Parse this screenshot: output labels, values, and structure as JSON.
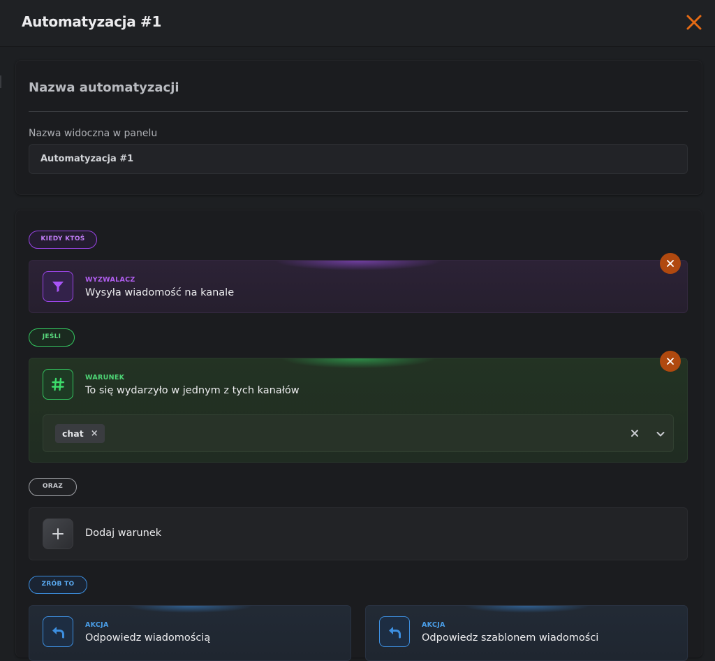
{
  "modal": {
    "title": "Automatyzacja #1",
    "close_icon": "close-icon",
    "accent_color": "#e46a14"
  },
  "name_section": {
    "title": "Nazwa automatyzacji",
    "field_label": "Nazwa widoczna w panelu",
    "field_value": "Automatyzacja #1"
  },
  "flow": {
    "when_pill": "KIEDY KTOŚ",
    "trigger": {
      "label": "WYZWALACZ",
      "description": "Wysyła wiadomość na kanale",
      "icon": "filter-icon",
      "color": "#9b45e8"
    },
    "if_pill": "JEŚLI",
    "condition": {
      "label": "WARUNEK",
      "description": "To się wydarzyło w jednym z tych kanałów",
      "icon": "hash-icon",
      "color": "#34c760",
      "selected_channels": [
        "chat"
      ]
    },
    "and_pill": "ORAZ",
    "add_condition": {
      "label": "Dodaj warunek",
      "icon": "plus-icon"
    },
    "do_pill": "ZRÓB TO",
    "actions": [
      {
        "label": "AKCJA",
        "description": "Odpowiedz wiadomością",
        "icon": "reply-icon"
      },
      {
        "label": "AKCJA",
        "description": "Odpowiedz szablonem wiadomości",
        "icon": "reply-icon"
      }
    ],
    "action_color": "#3d8fe0"
  }
}
